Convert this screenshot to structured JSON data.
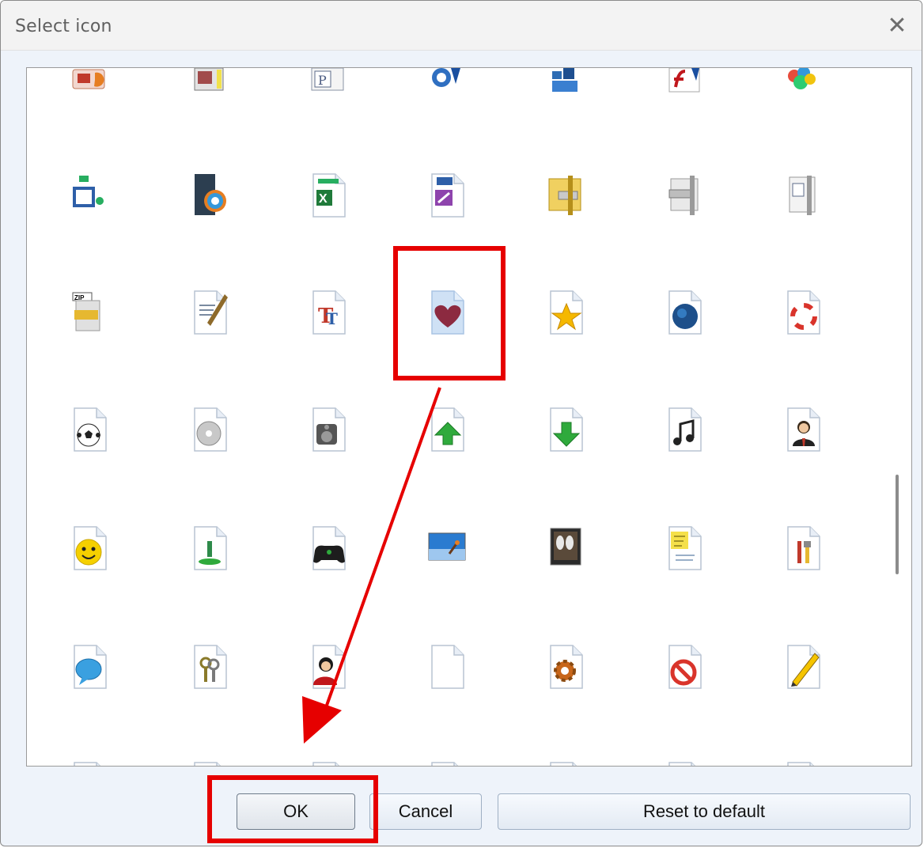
{
  "window": {
    "title": "Select icon",
    "close_symbol": "✕"
  },
  "icons": [
    [
      "office-slides-icon",
      "publisher-icon",
      "powerpoint-p-icon",
      "quicktime-icon",
      "database-blocks-icon",
      "flash-icon",
      "balloons-icon"
    ],
    [
      "visio-flow-icon",
      "video-media-icon",
      "excel-icon",
      "access-form-icon",
      "winzip-archive-icon",
      "zip-clamp-icon",
      "compressed-file-icon"
    ],
    [
      "zip-file-icon",
      "document-pen-icon",
      "font-tt-icon",
      "heart-file-icon",
      "star-file-icon",
      "globe-file-icon",
      "lifebuoy-file-icon"
    ],
    [
      "soccer-ball-file-icon",
      "cd-disc-file-icon",
      "audio-speaker-file-icon",
      "up-arrow-file-icon",
      "down-arrow-file-icon",
      "music-note-file-icon",
      "user-file-icon"
    ],
    [
      "smiley-file-icon",
      "install-file-icon",
      "gamepad-file-icon",
      "picture-file-icon",
      "photo-file-icon",
      "notes-file-icon",
      "tools-file-icon"
    ],
    [
      "chat-bubble-file-icon",
      "keys-file-icon",
      "person-red-file-icon",
      "blank-file-icon",
      "settings-gear-file-icon",
      "blocked-file-icon",
      "pencil-file-icon"
    ]
  ],
  "selected_icon": "heart-file-icon",
  "buttons": {
    "ok": "OK",
    "cancel": "Cancel",
    "reset": "Reset to default"
  },
  "annotation_color": "#e60000"
}
